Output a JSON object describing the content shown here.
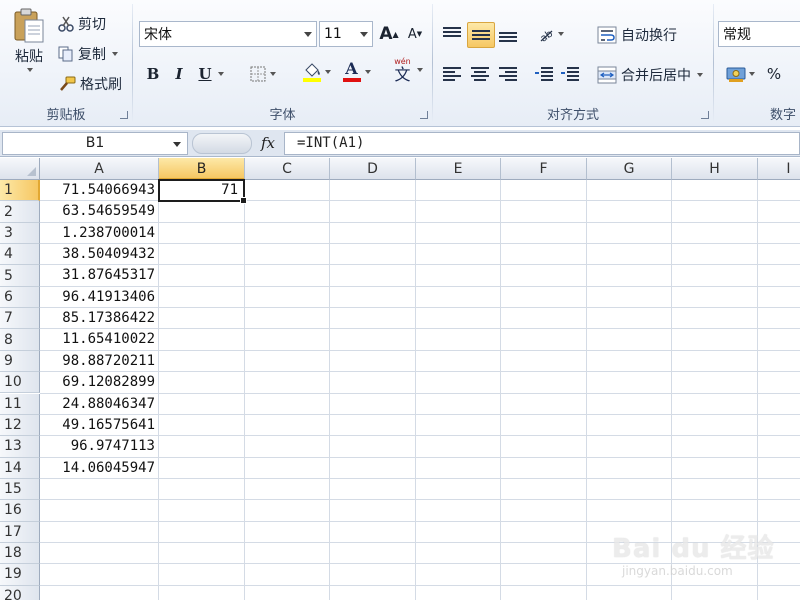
{
  "ribbon": {
    "clipboard": {
      "paste": "粘贴",
      "cut": "剪切",
      "copy": "复制",
      "format_painter": "格式刷",
      "group_label": "剪贴板"
    },
    "font": {
      "font_name": "宋体",
      "font_size": "11",
      "bold": "B",
      "italic": "I",
      "underline": "U",
      "grow": "A",
      "shrink": "A",
      "font_color_letter": "A",
      "phonetic": "wén",
      "phonetic_char": "文",
      "group_label": "字体",
      "fill_color": "#ffff00",
      "font_color": "#e01010"
    },
    "alignment": {
      "wrap_text": "自动换行",
      "merge_center": "合并后居中",
      "group_label": "对齐方式"
    },
    "number": {
      "format": "常规",
      "percent": "%",
      "group_label": "数字"
    }
  },
  "formula_bar": {
    "name_box": "B1",
    "fx": "fx",
    "formula": "=INT(A1)"
  },
  "sheet": {
    "columns": [
      "A",
      "B",
      "C",
      "D",
      "E",
      "F",
      "G",
      "H",
      "I"
    ],
    "rows": [
      "1",
      "2",
      "3",
      "4",
      "5",
      "6",
      "7",
      "8",
      "9",
      "10",
      "11",
      "12",
      "13",
      "14",
      "15",
      "16",
      "17",
      "18",
      "19",
      "20"
    ],
    "col_a_values": [
      "71.54066943",
      "63.54659549",
      "1.238700014",
      "38.50409432",
      "31.87645317",
      "96.41913406",
      "85.17386422",
      "11.65410022",
      "98.88720211",
      "69.12082899",
      "24.88046347",
      "49.16575641",
      "96.9747113",
      "14.06045947"
    ],
    "b1_value": "71",
    "active_cell": "B1"
  },
  "watermark": {
    "brand": "Bai du 经验",
    "url": "jingyan.baidu.com"
  }
}
